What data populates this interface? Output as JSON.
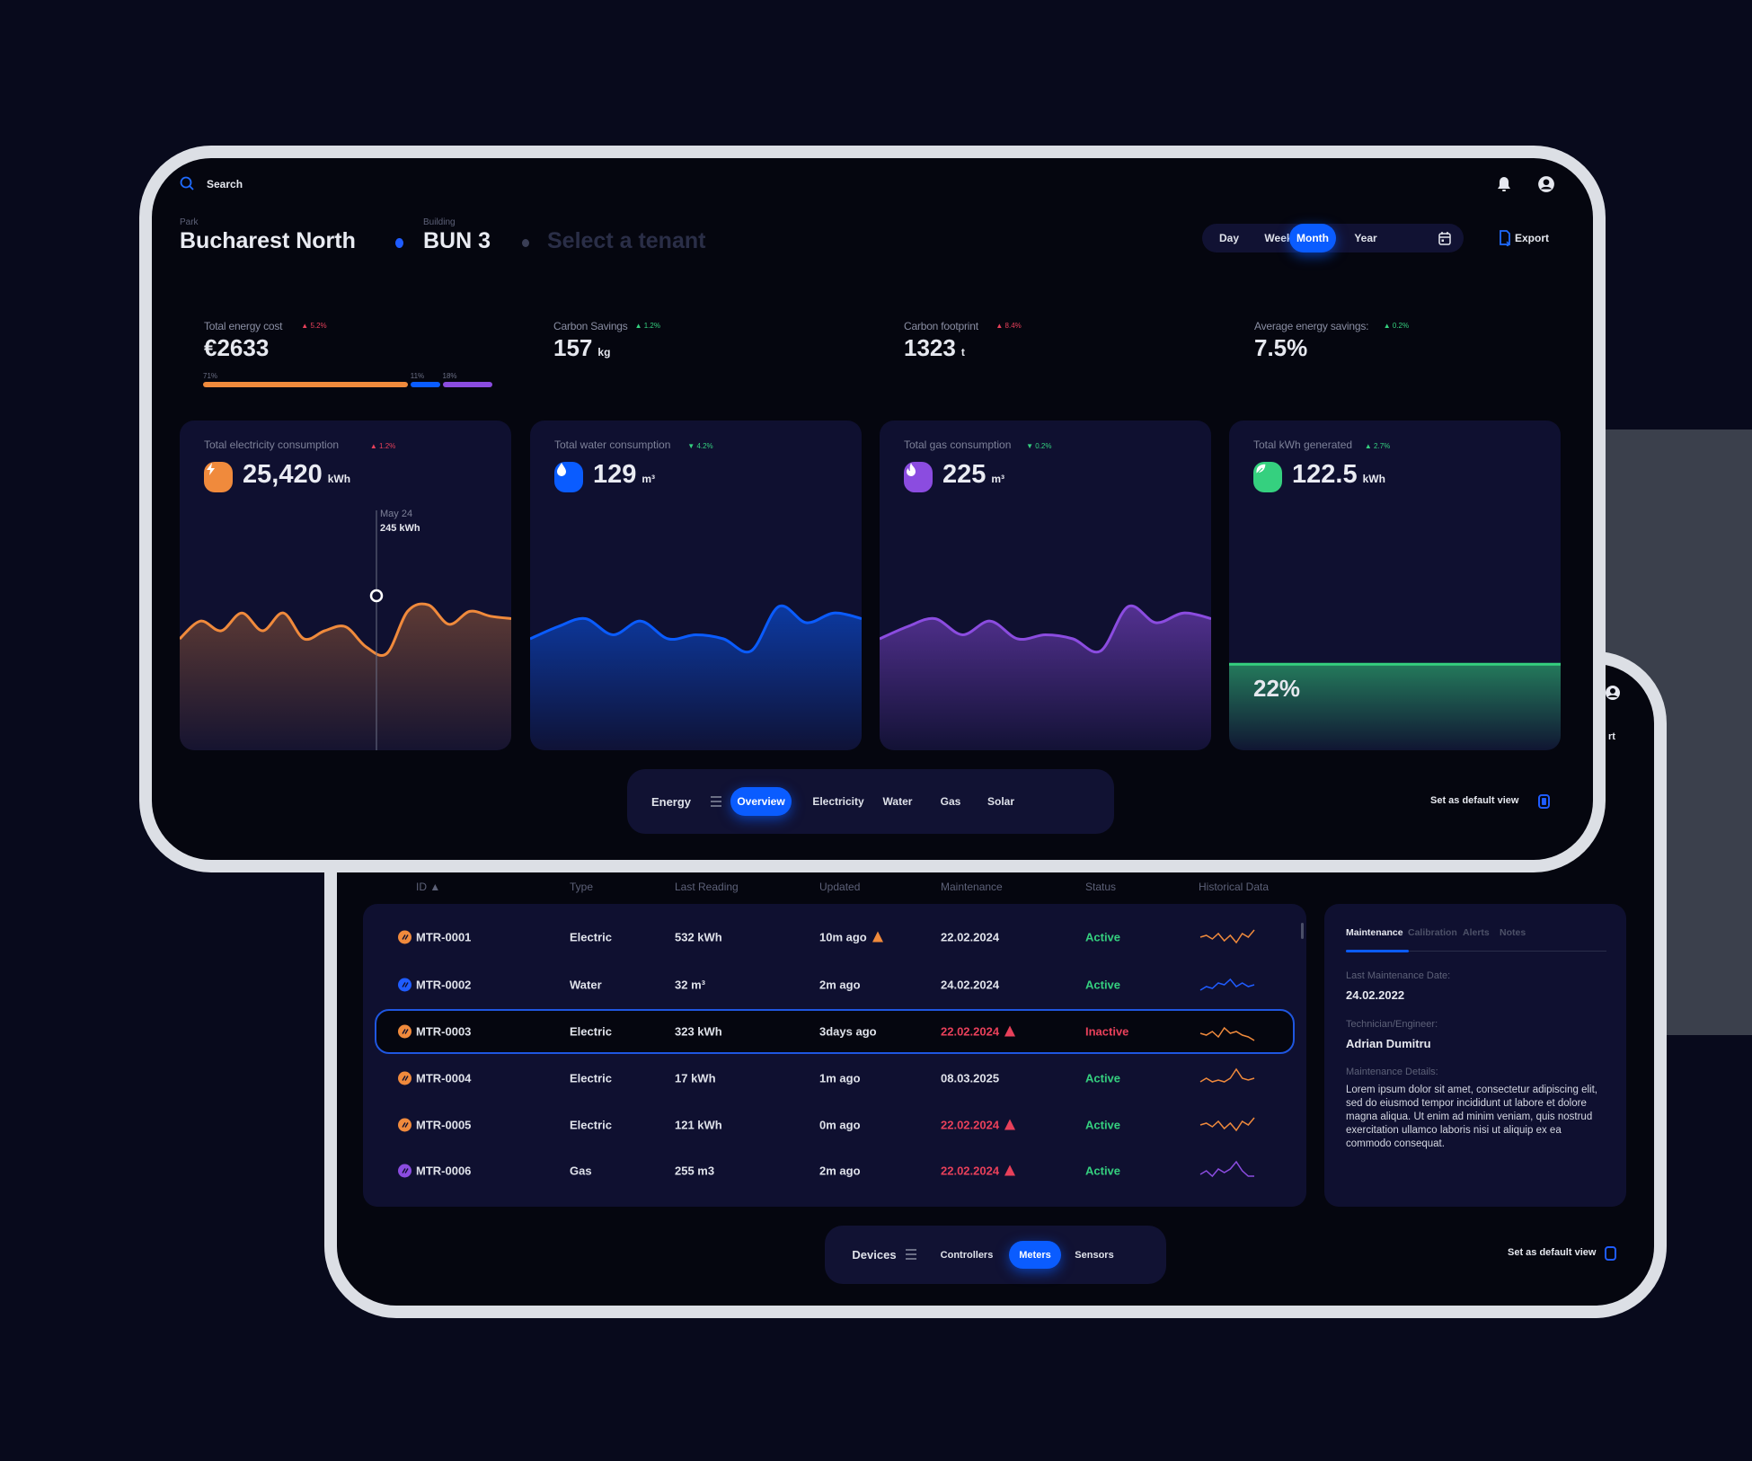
{
  "front": {
    "search_label": "Search",
    "breadcrumb": {
      "park_label": "Park",
      "park": "Bucharest North",
      "building_label": "Building",
      "building": "BUN 3",
      "tenant_placeholder": "Select a tenant"
    },
    "periods": [
      {
        "label": "Day",
        "active": false
      },
      {
        "label": "Week",
        "active": false
      },
      {
        "label": "Month",
        "active": true
      },
      {
        "label": "Year",
        "active": false
      }
    ],
    "export_label": "Export",
    "kpis": [
      {
        "label": "Total energy cost",
        "delta": "▲ 5.2%",
        "trend": "bad",
        "value": "€2633",
        "unit": ""
      },
      {
        "label": "Carbon Savings",
        "delta": "▲ 1.2%",
        "trend": "good",
        "value": "157",
        "unit": "kg"
      },
      {
        "label": "Carbon footprint",
        "delta": "▲ 8.4%",
        "trend": "bad",
        "value": "1323",
        "unit": "t"
      },
      {
        "label": "Average energy savings:",
        "delta": "▲ 0.2%",
        "trend": "good",
        "value": "7.5%",
        "unit": ""
      }
    ],
    "cost_split": [
      {
        "label": "71%",
        "value": 71,
        "color": "#f08a3c"
      },
      {
        "label": "11%",
        "value": 11,
        "color": "#0a5cff"
      },
      {
        "label": "18%",
        "value": 18,
        "color": "#8b4ce0"
      }
    ],
    "cards": [
      {
        "label": "Total electricity consumption",
        "delta": "▲ 1.2%",
        "trend": "bad",
        "value": "25,420",
        "unit": "kWh",
        "icon": "lightning-icon",
        "color": "#f08a3c",
        "series": [
          30,
          52,
          40,
          62,
          40,
          62,
          30,
          40,
          45,
          20,
          12,
          64,
          72,
          48,
          64,
          58,
          55
        ],
        "tooltip": {
          "date": "May 24",
          "value": "245 kWh"
        }
      },
      {
        "label": "Total water consumption",
        "delta": "▼ 4.2%",
        "trend": "good",
        "value": "129",
        "unit": "m³",
        "icon": "water-drop-icon",
        "color": "#0a5cff",
        "series": [
          30,
          45,
          55,
          35,
          52,
          30,
          35,
          30,
          15,
          70,
          50,
          62,
          55
        ]
      },
      {
        "label": "Total gas consumption",
        "delta": "▼ 0.2%",
        "trend": "good",
        "value": "225",
        "unit": "m³",
        "icon": "flame-icon",
        "color": "#8b4ce0",
        "series": [
          30,
          45,
          55,
          35,
          52,
          30,
          35,
          30,
          15,
          70,
          50,
          62,
          55
        ]
      },
      {
        "label": "Total kWh generated",
        "delta": "▲ 2.7%",
        "trend": "good",
        "value": "122.5",
        "unit": "kWh",
        "icon": "leaf-icon",
        "color": "#35d07f",
        "percent": "22%",
        "fill": 22
      }
    ],
    "view_tabs": {
      "group": "Energy",
      "items": [
        {
          "label": "Overview",
          "active": true
        },
        {
          "label": "Electricity",
          "active": false
        },
        {
          "label": "Water",
          "active": false
        },
        {
          "label": "Gas",
          "active": false
        },
        {
          "label": "Solar",
          "active": false
        }
      ]
    },
    "default_view_label": "Set as default view"
  },
  "back": {
    "peek_export": "rt",
    "columns": [
      "ID ▲",
      "Type",
      "Last Reading",
      "Updated",
      "Maintenance",
      "Status",
      "Historical Data"
    ],
    "rows": [
      {
        "id": "MTR-0001",
        "type": "Electric",
        "reading": "532 kWh",
        "updated": "10m ago",
        "updated_warn": true,
        "maintenance": "22.02.2024",
        "maint_warn": false,
        "status": "Active",
        "color": "#f08a3c",
        "spark": [
          5,
          6,
          4,
          7,
          3,
          6,
          2,
          7,
          5,
          9
        ]
      },
      {
        "id": "MTR-0002",
        "type": "Water",
        "reading": "32 m³",
        "updated": "2m ago",
        "updated_warn": false,
        "maintenance": "24.02.2024",
        "maint_warn": false,
        "status": "Active",
        "color": "#1f5cff",
        "spark": [
          2,
          4,
          3,
          6,
          5,
          8,
          4,
          6,
          4,
          5
        ]
      },
      {
        "id": "MTR-0003",
        "type": "Electric",
        "reading": "323 kWh",
        "updated": "3days ago",
        "updated_warn": false,
        "maintenance": "22.02.2024",
        "maint_warn": true,
        "status": "Inactive",
        "color": "#f08a3c",
        "spark": [
          5,
          4,
          6,
          3,
          8,
          5,
          6,
          4,
          3,
          1
        ]
      },
      {
        "id": "MTR-0004",
        "type": "Electric",
        "reading": "17 kWh",
        "updated": "1m ago",
        "updated_warn": false,
        "maintenance": "08.03.2025",
        "maint_warn": false,
        "status": "Active",
        "color": "#f08a3c",
        "spark": [
          3,
          5,
          3,
          4,
          3,
          5,
          10,
          5,
          4,
          5
        ]
      },
      {
        "id": "MTR-0005",
        "type": "Electric",
        "reading": "121 kWh",
        "updated": "0m ago",
        "updated_warn": false,
        "maintenance": "22.02.2024",
        "maint_warn": true,
        "status": "Active",
        "color": "#f08a3c",
        "spark": [
          5,
          6,
          4,
          7,
          3,
          6,
          2,
          7,
          5,
          9
        ]
      },
      {
        "id": "MTR-0006",
        "type": "Gas",
        "reading": "255 m3",
        "updated": "2m ago",
        "updated_warn": false,
        "maintenance": "22.02.2024",
        "maint_warn": true,
        "status": "Active",
        "color": "#8b4ce0",
        "spark": [
          3,
          5,
          2,
          6,
          4,
          6,
          10,
          5,
          2,
          2
        ]
      }
    ],
    "detail": {
      "tabs": [
        {
          "label": "Maintenance",
          "active": true
        },
        {
          "label": "Calibration",
          "active": false
        },
        {
          "label": "Alerts",
          "active": false
        },
        {
          "label": "Notes",
          "active": false
        }
      ],
      "last_date_label": "Last Maintenance Date:",
      "last_date": "24.02.2022",
      "tech_label": "Technician/Engineer:",
      "tech": "Adrian Dumitru",
      "details_label": "Maintenance Details:",
      "details": "Lorem ipsum dolor sit amet, consectetur adipiscing elit, sed do eiusmod tempor incididunt ut labore et dolore magna aliqua. Ut enim ad minim veniam, quis nostrud exercitation ullamco laboris nisi ut aliquip ex ea commodo consequat."
    },
    "device_tabs": {
      "group": "Devices",
      "items": [
        {
          "label": "Controllers",
          "active": false
        },
        {
          "label": "Meters",
          "active": true
        },
        {
          "label": "Sensors",
          "active": false
        }
      ]
    },
    "default_view_label": "Set as default view"
  },
  "colors": {
    "accent": "#0a5cff",
    "active": "#35d07f",
    "alert": "#e8405a",
    "warning": "#f08a3c"
  }
}
